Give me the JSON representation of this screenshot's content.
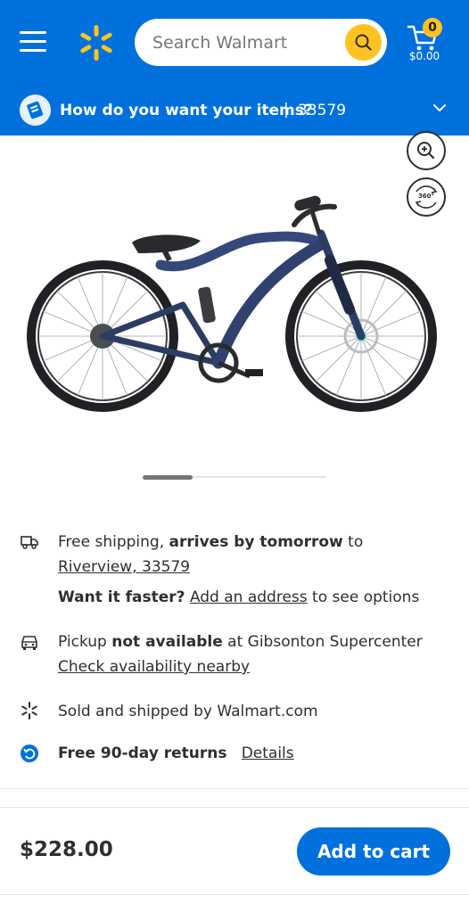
{
  "header": {
    "search_placeholder": "Search Walmart",
    "cart_count": "0",
    "cart_total": "$0.00"
  },
  "delivery": {
    "question": "How do you want your items?",
    "separator": "|",
    "zip": "33579"
  },
  "product": {
    "image_icons": [
      "zoom-icon",
      "360-view-icon"
    ],
    "view360_label": "360°",
    "carousel_progress": 0.27
  },
  "shipping": {
    "prefix": "Free shipping, ",
    "arrival": "arrives by tomorrow",
    "suffix": " to",
    "location_link": "Riverview, 33579",
    "faster_q": "Want it faster?",
    "add_address_link": "Add an address",
    "faster_suffix": " to see options"
  },
  "pickup": {
    "prefix": "Pickup ",
    "status": "not available",
    "store": " at Gibsonton Supercenter",
    "check_link": "Check availability nearby"
  },
  "seller": {
    "text": "Sold and shipped by Walmart.com"
  },
  "returns": {
    "text": "Free 90-day returns",
    "details_link": "Details"
  },
  "purchase": {
    "price": "$228.00",
    "add_to_cart": "Add to cart"
  },
  "colors": {
    "brand_blue": "#0071dc",
    "brand_yellow": "#ffc220",
    "text": "#2e2f32"
  }
}
